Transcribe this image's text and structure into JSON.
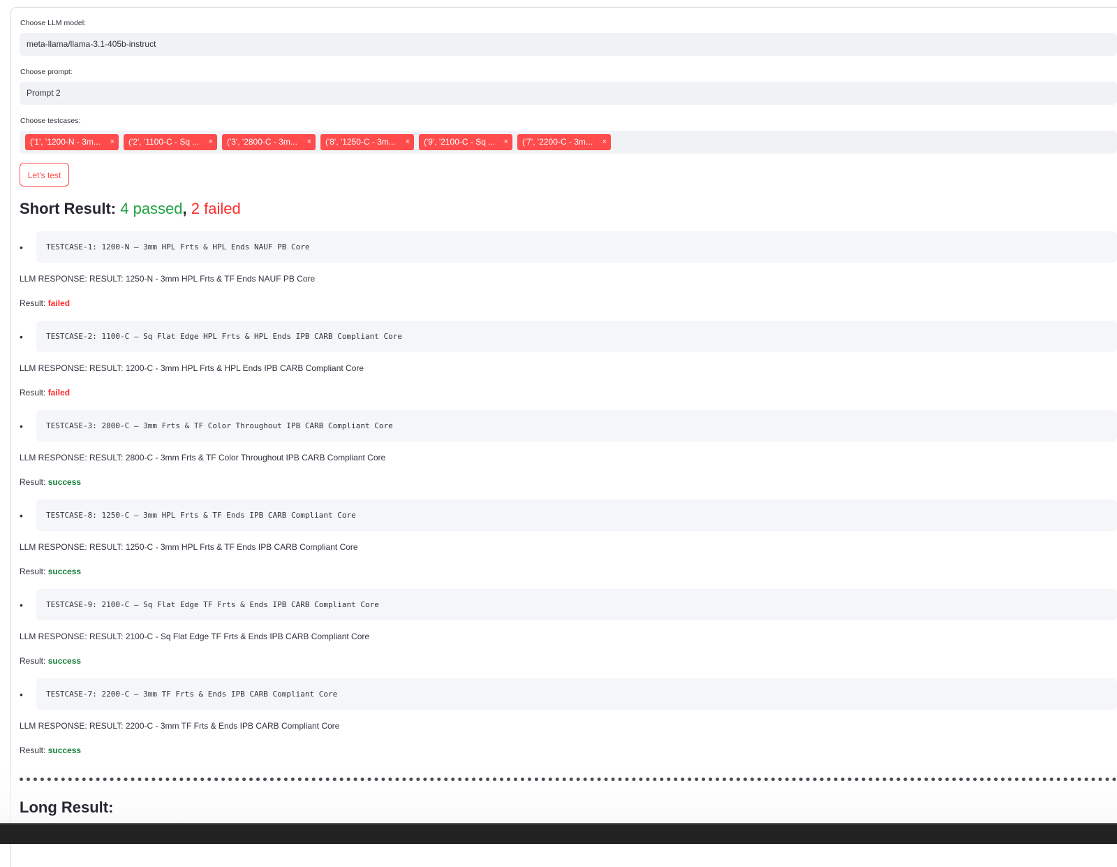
{
  "form": {
    "model_label": "Choose LLM model:",
    "model_value": "meta-llama/llama-3.1-405b-instruct",
    "prompt_label": "Choose prompt:",
    "prompt_value": "Prompt 2",
    "testcases_label": "Choose testcases:",
    "testcase_tags": [
      "('1', '1200-N - 3m...",
      "('2', '1100-C - Sq ...",
      "('3', '2800-C - 3m...",
      "('8', '1250-C - 3m...",
      "('9', '2100-C - Sq ...",
      "('7', '2200-C - 3m..."
    ],
    "remove_glyph": "×",
    "button_label": "Let's test"
  },
  "short_result": {
    "heading_prefix": "Short Result: ",
    "passed_text": "4 passed",
    "separator": ", ",
    "failed_text": "2 failed"
  },
  "results": [
    {
      "testcase": "TESTCASE-1: 1200-N – 3mm HPL Frts & HPL Ends NAUF PB Core",
      "response": "LLM RESPONSE: RESULT: 1250-N - 3mm HPL Frts & TF Ends NAUF PB Core",
      "result_label": "Result: ",
      "status": "failed"
    },
    {
      "testcase": "TESTCASE-2: 1100-C – Sq Flat Edge HPL Frts & HPL Ends IPB CARB Compliant Core",
      "response": "LLM RESPONSE: RESULT: 1200-C - 3mm HPL Frts & HPL Ends IPB CARB Compliant Core",
      "result_label": "Result: ",
      "status": "failed"
    },
    {
      "testcase": "TESTCASE-3: 2800-C – 3mm Frts & TF Color Throughout IPB CARB Compliant Core",
      "response": "LLM RESPONSE: RESULT: 2800-C - 3mm Frts & TF Color Throughout IPB CARB Compliant Core",
      "result_label": "Result: ",
      "status": "success"
    },
    {
      "testcase": "TESTCASE-8: 1250-C – 3mm HPL Frts & TF Ends IPB CARB Compliant Core",
      "response": "LLM RESPONSE: RESULT: 1250-C - 3mm HPL Frts & TF Ends IPB CARB Compliant Core",
      "result_label": "Result: ",
      "status": "success"
    },
    {
      "testcase": "TESTCASE-9: 2100-C – Sq Flat Edge TF Frts & Ends IPB CARB Compliant Core",
      "response": "LLM RESPONSE: RESULT: 2100-C - Sq Flat Edge TF Frts & Ends IPB CARB Compliant Core",
      "result_label": "Result: ",
      "status": "success"
    },
    {
      "testcase": "TESTCASE-7: 2200-C – 3mm TF Frts & Ends IPB CARB Compliant Core",
      "response": "LLM RESPONSE: RESULT: 2200-C - 3mm TF Frts & Ends IPB CARB Compliant Core",
      "result_label": "Result: ",
      "status": "success"
    }
  ],
  "bullet_glyph": "•",
  "long_result_heading": "Long Result:",
  "colors": {
    "accent": "#ff4b4b",
    "success": "#16803c",
    "passed": "#21a043",
    "failed": "#ff2b2b",
    "field_bg": "#f0f2f6"
  }
}
